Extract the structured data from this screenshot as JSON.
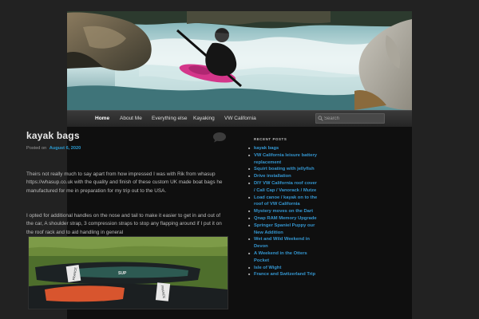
{
  "nav": {
    "items": [
      {
        "label": "Home",
        "active": true
      },
      {
        "label": "About Me"
      },
      {
        "label": "Everything else"
      },
      {
        "label": "Kayaking"
      },
      {
        "label": "VW California"
      }
    ],
    "search_placeholder": "Search"
  },
  "post": {
    "title": "kayak bags",
    "posted_on": "Posted on",
    "date": "August 6, 2020",
    "paragraph1": "Theirs not really much to say apart from how impressed I was with Rik from whasup https://whasup.co.uk with the quality and finish of these custom UK made boat bags he manufactured for me in preparation for my trip out to the USA.",
    "paragraph2": "I opted for additional handles on the nose and tail to make it easier to get in and out of the car, A shoulder strap, 3 compression straps to stop any flapping around if I put it on the roof rack and to aid handling in general",
    "image_bag_labels": [
      "FRANCE",
      "SUP",
      "FRANCE"
    ]
  },
  "sidebar": {
    "heading": "RECENT POSTS",
    "recent_posts": [
      "kayak bags",
      "VW California leisure battery replacement",
      "Squirt boating with jellyfish",
      "Drive installation",
      "DIY VW California roof cover / Cali Cap / Vanorack / Mutze",
      "Load canoe / kayak on to the roof of VW California",
      "Mystery moves on the Dart",
      "Qnap RAM Memory Upgrade",
      "Springer Spaniel Puppy our New Addition",
      "Wet and Wild Weekend in Devon",
      "A Weekend in the Otters Pocket",
      "Isle of Wight",
      "France and Switzerland Trip"
    ]
  },
  "colors": {
    "link": "#3496d0",
    "background": "#222222",
    "page": "#0f0f0f"
  }
}
